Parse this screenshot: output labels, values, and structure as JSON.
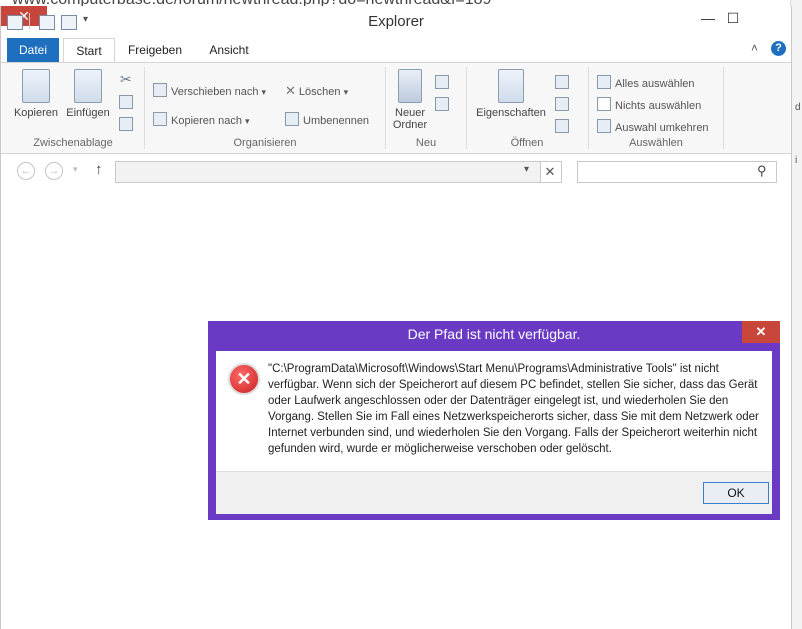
{
  "browser_background": {
    "url_fragment": "www.computerbase.de/forum/newthread.php?do=newthread&f=189"
  },
  "explorer": {
    "title": "Explorer",
    "window_buttons": {
      "minimize": "—",
      "maximize": "☐",
      "close": "✕"
    },
    "tabs": [
      "Datei",
      "Start",
      "Freigeben",
      "Ansicht"
    ],
    "ribbon": {
      "groups": {
        "zwischenablage": {
          "label": "Zwischenablage",
          "kopieren": "Kopieren",
          "einfuegen": "Einfügen"
        },
        "organisieren": {
          "label": "Organisieren",
          "verschieben": "Verschieben nach",
          "kopieren_nach": "Kopieren nach",
          "loeschen": "Löschen",
          "umbenennen": "Umbenennen"
        },
        "neu": {
          "label": "Neu",
          "neuer_ordner_line1": "Neuer",
          "neuer_ordner_line2": "Ordner"
        },
        "oeffnen": {
          "label": "Öffnen",
          "eigenschaften": "Eigenschaften"
        },
        "auswaehlen": {
          "label": "Auswählen",
          "alles": "Alles auswählen",
          "nichts": "Nichts auswählen",
          "umkehren": "Auswahl umkehren"
        }
      }
    },
    "address": {
      "path": "",
      "search_placeholder": ""
    }
  },
  "dialog": {
    "title": "Der Pfad ist nicht verfügbar.",
    "close": "✕",
    "message": "\"C:\\ProgramData\\Microsoft\\Windows\\Start Menu\\Programs\\Administrative Tools\" ist nicht verfügbar. Wenn sich der Speicherort auf diesem PC befindet, stellen Sie sicher, dass das Gerät oder Laufwerk angeschlossen oder der Datenträger eingelegt ist, und wiederholen Sie den Vorgang. Stellen Sie im Fall eines Netzwerkspeicherorts sicher, dass Sie mit dem Netzwerk oder Internet verbunden sind, und wiederholen Sie den Vorgang. Falls der Speicherort weiterhin nicht gefunden wird, wurde er möglicherweise verschoben oder gelöscht.",
    "ok_label": "OK"
  },
  "colors": {
    "dialog_frame": "#6a3ac4",
    "close_red": "#c8463a",
    "accent_blue": "#1f6fbf"
  }
}
